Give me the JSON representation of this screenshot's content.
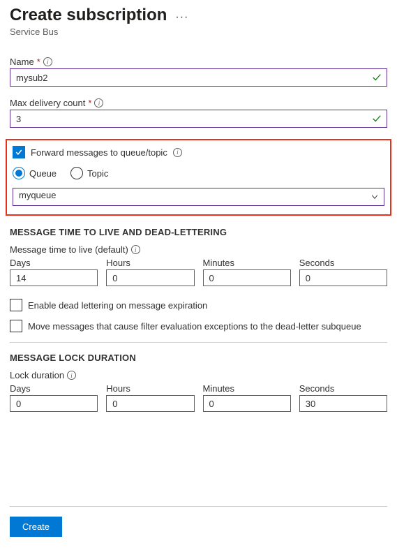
{
  "header": {
    "title": "Create subscription",
    "subtitle": "Service Bus"
  },
  "fields": {
    "name": {
      "label": "Name",
      "value": "mysub2"
    },
    "maxDelivery": {
      "label": "Max delivery count",
      "value": "3"
    }
  },
  "forward": {
    "checkbox_label": "Forward messages to queue/topic",
    "radio_queue": "Queue",
    "radio_topic": "Topic",
    "selected": "myqueue"
  },
  "ttlSection": {
    "heading": "MESSAGE TIME TO LIVE AND DEAD-LETTERING",
    "sublabel": "Message time to live (default)",
    "days_label": "Days",
    "days": "14",
    "hours_label": "Hours",
    "hours": "0",
    "minutes_label": "Minutes",
    "minutes": "0",
    "seconds_label": "Seconds",
    "seconds": "0",
    "deadletter_label": "Enable dead lettering on message expiration",
    "filterex_label": "Move messages that cause filter evaluation exceptions to the dead-letter subqueue"
  },
  "lockSection": {
    "heading": "MESSAGE LOCK DURATION",
    "sublabel": "Lock duration",
    "days_label": "Days",
    "days": "0",
    "hours_label": "Hours",
    "hours": "0",
    "minutes_label": "Minutes",
    "minutes": "0",
    "seconds_label": "Seconds",
    "seconds": "30"
  },
  "footer": {
    "create": "Create"
  }
}
